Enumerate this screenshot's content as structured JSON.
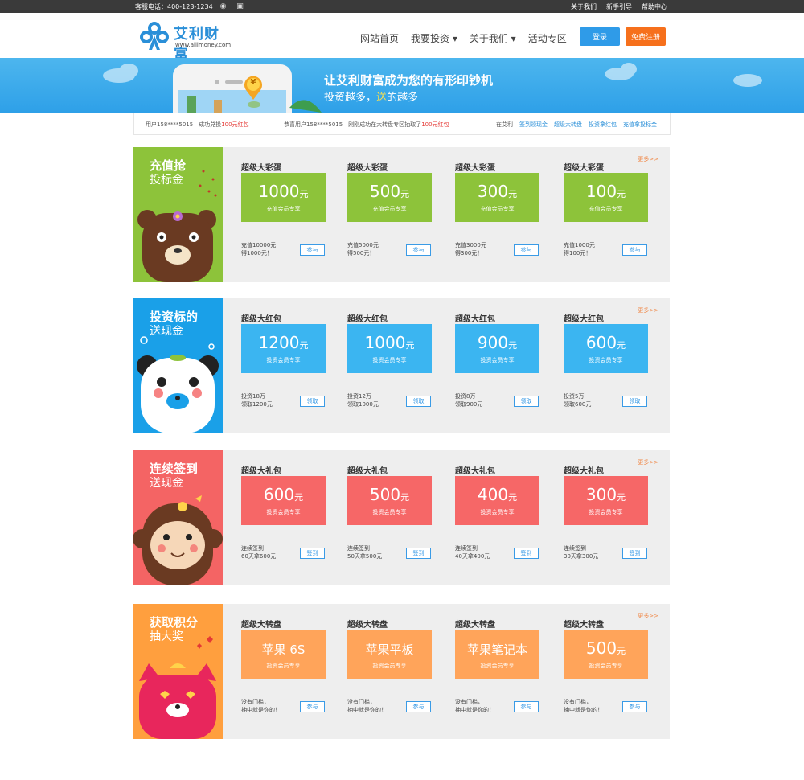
{
  "topbar": {
    "phone": "客服电话：400-123-1234",
    "icons": [
      "weibo-icon",
      "android-icon",
      "apple-icon"
    ],
    "links": [
      "关于我们",
      "新手引导",
      "帮助中心"
    ]
  },
  "header": {
    "logo_name": "艾利财富",
    "logo_url": "www.ailimoney.com",
    "nav": [
      "网站首页",
      "我要投资 ▾",
      "关于我们 ▾",
      "活动专区"
    ],
    "login": "登录",
    "register": "免费注册"
  },
  "banner": {
    "headline": "让艾利财富成为您的有形印钞机",
    "sub_before": "投资越多，",
    "sub_highlight": "送",
    "sub_after": "的越多",
    "coin": "¥"
  },
  "notice": {
    "left_text": "用户158****5015　成功兑换",
    "left_red": "100元红包",
    "mid_text": "恭喜用户158****5015　刚刚成功在大转盘专区抽取了",
    "mid_red": "100元红包",
    "right_label": "在艾利",
    "right_links": [
      "签到领现金",
      "超级大转盘",
      "投资拿红包",
      "充值拿投标金"
    ]
  },
  "colors": {
    "green": "#8dc33a",
    "blue": "#3bb5f1",
    "red": "#f66767",
    "orange": "#ffa45a",
    "panel_green": "#8dc33a",
    "panel_blue": "#1aa0e8",
    "panel_red": "#f46464",
    "panel_orange": "#ff9f3e"
  },
  "more": "更多>>",
  "sections": [
    {
      "title1": "充值抢",
      "title2": "投标金",
      "cards": [
        {
          "title": "超级大彩蛋",
          "amount": "1000",
          "unit": "元",
          "sub": "充值会员专享",
          "desc": "充值10000元\n得1000元！",
          "action": "参与"
        },
        {
          "title": "超级大彩蛋",
          "amount": "500",
          "unit": "元",
          "sub": "充值会员专享",
          "desc": "充值5000元\n得500元！",
          "action": "参与"
        },
        {
          "title": "超级大彩蛋",
          "amount": "300",
          "unit": "元",
          "sub": "充值会员专享",
          "desc": "充值3000元\n得300元！",
          "action": "参与"
        },
        {
          "title": "超级大彩蛋",
          "amount": "100",
          "unit": "元",
          "sub": "充值会员专享",
          "desc": "充值1000元\n得100元！",
          "action": "参与"
        }
      ]
    },
    {
      "title1": "投资标的",
      "title2": "送现金",
      "cards": [
        {
          "title": "超级大红包",
          "amount": "1200",
          "unit": "元",
          "sub": "投资会员专享",
          "desc": "投资18万\n领取1200元",
          "action": "领取"
        },
        {
          "title": "超级大红包",
          "amount": "1000",
          "unit": "元",
          "sub": "投资会员专享",
          "desc": "投资12万\n领取1000元",
          "action": "领取"
        },
        {
          "title": "超级大红包",
          "amount": "900",
          "unit": "元",
          "sub": "投资会员专享",
          "desc": "投资8万\n领取900元",
          "action": "领取"
        },
        {
          "title": "超级大红包",
          "amount": "600",
          "unit": "元",
          "sub": "投资会员专享",
          "desc": "投资5万\n领取600元",
          "action": "领取"
        }
      ]
    },
    {
      "title1": "连续签到",
      "title2": "送现金",
      "cards": [
        {
          "title": "超级大礼包",
          "amount": "600",
          "unit": "元",
          "sub": "投资会员专享",
          "desc": "连续签到\n60天拿600元",
          "action": "签到"
        },
        {
          "title": "超级大礼包",
          "amount": "500",
          "unit": "元",
          "sub": "投资会员专享",
          "desc": "连续签到\n50天拿500元",
          "action": "签到"
        },
        {
          "title": "超级大礼包",
          "amount": "400",
          "unit": "元",
          "sub": "投资会员专享",
          "desc": "连续签到\n40天拿400元",
          "action": "签到"
        },
        {
          "title": "超级大礼包",
          "amount": "300",
          "unit": "元",
          "sub": "投资会员专享",
          "desc": "连续签到\n30天拿300元",
          "action": "签到"
        }
      ]
    },
    {
      "title1": "获取积分",
      "title2": "抽大奖",
      "cards": [
        {
          "title": "超级大转盘",
          "amount": "苹果 6S",
          "unit": "",
          "sub": "投资会员专享",
          "desc": "没有门槛，\n抽中就是你的！",
          "action": "参与"
        },
        {
          "title": "超级大转盘",
          "amount": "苹果平板",
          "unit": "",
          "sub": "投资会员专享",
          "desc": "没有门槛，\n抽中就是你的！",
          "action": "参与"
        },
        {
          "title": "超级大转盘",
          "amount": "苹果笔记本",
          "unit": "",
          "sub": "投资会员专享",
          "desc": "没有门槛，\n抽中就是你的！",
          "action": "参与"
        },
        {
          "title": "超级大转盘",
          "amount": "500",
          "unit": "元",
          "sub": "投资会员专享",
          "desc": "没有门槛，\n抽中就是你的！",
          "action": "参与"
        }
      ]
    }
  ]
}
